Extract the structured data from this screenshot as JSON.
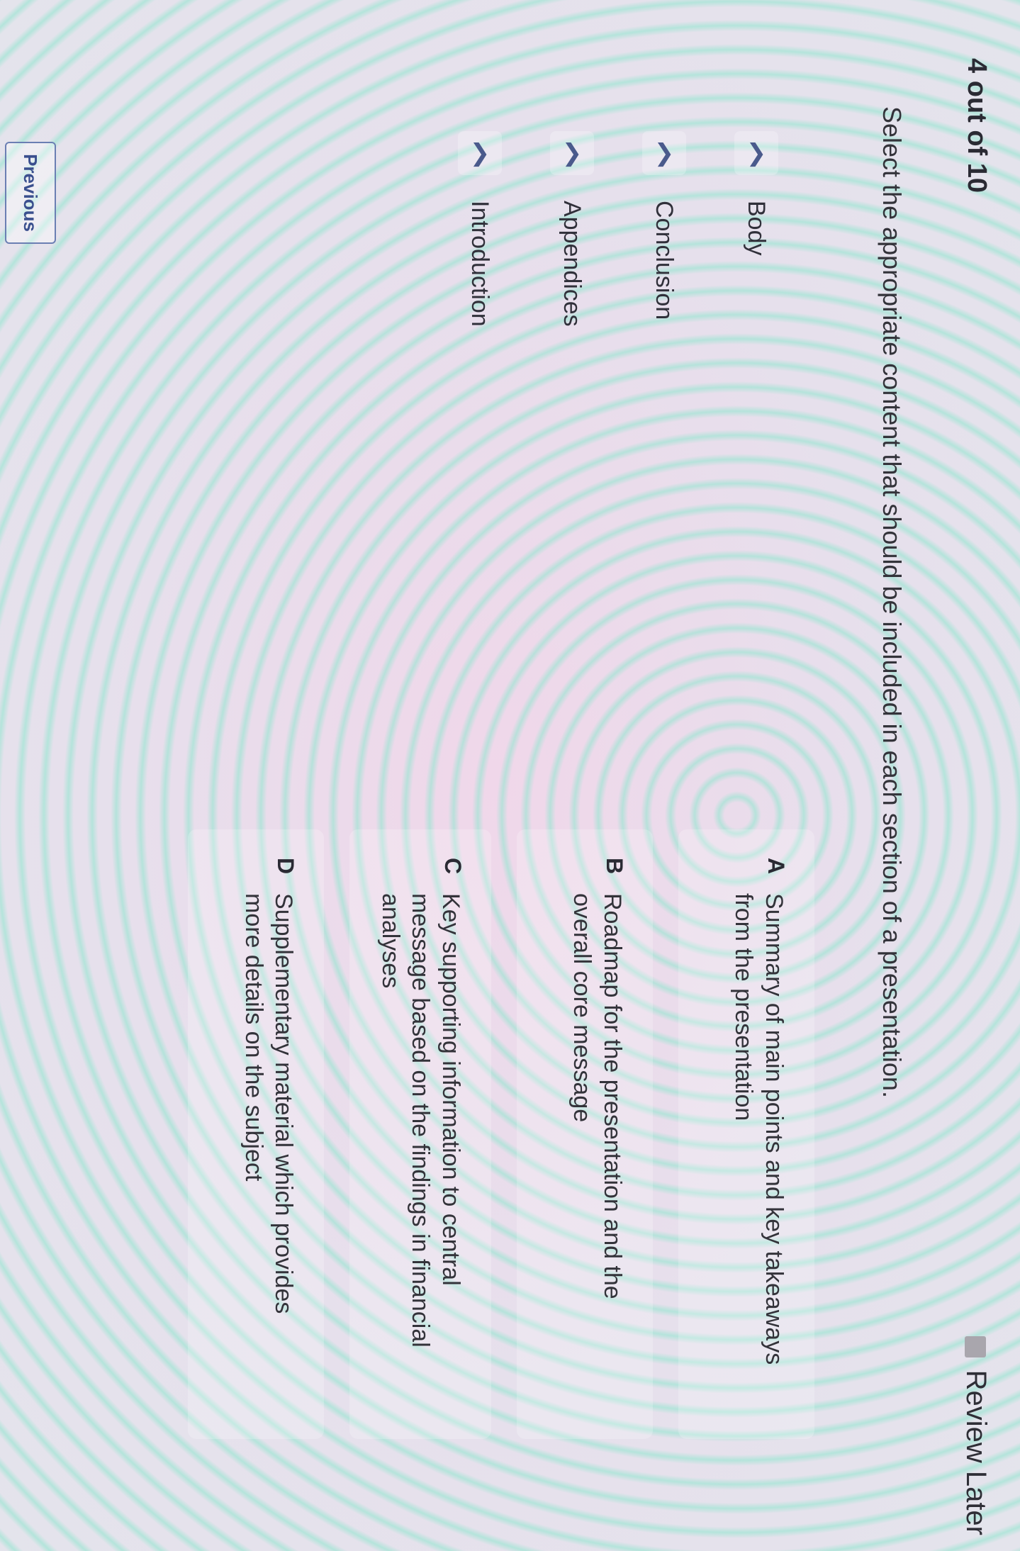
{
  "header": {
    "progress": "4 out of 10",
    "review_later": "Review Later"
  },
  "question": {
    "prompt": "Select the appropriate content that should be included in each section of a presentation."
  },
  "sections": [
    {
      "label": "Body",
      "icon": "chevron-down-icon"
    },
    {
      "label": "Conclusion",
      "icon": "chevron-down-icon"
    },
    {
      "label": "Appendices",
      "icon": "chevron-down-icon"
    },
    {
      "label": "Introduction",
      "icon": "chevron-down-icon"
    }
  ],
  "options": [
    {
      "letter": "A",
      "text": "Summary of main points and key takeaways from the presentation"
    },
    {
      "letter": "B",
      "text": "Roadmap for the presentation and the overall core message"
    },
    {
      "letter": "C",
      "text": "Key supporting information to central message based on the findings in financial analyses"
    },
    {
      "letter": "D",
      "text": "Supplementary material which provides more details on the subject"
    }
  ],
  "footer": {
    "previous_label": "Previous"
  },
  "colors": {
    "accent": "#3a4f8e",
    "text": "#2b2b33"
  }
}
